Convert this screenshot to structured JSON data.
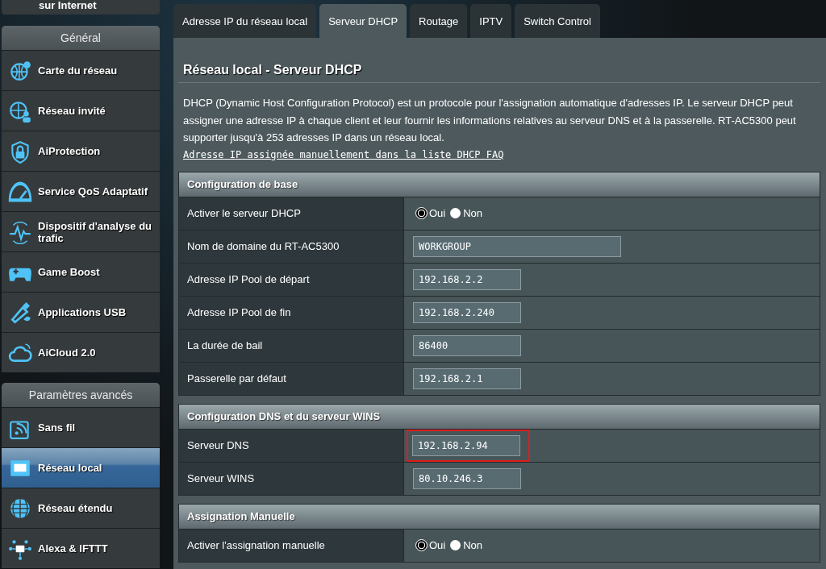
{
  "sidebar": {
    "top_item": "sur Internet",
    "sections": [
      {
        "title": "Général",
        "items": [
          {
            "label": "Carte du réseau",
            "selected": false
          },
          {
            "label": "Réseau invité",
            "selected": false
          },
          {
            "label": "AiProtection",
            "selected": false
          },
          {
            "label": "Service QoS Adaptatif",
            "selected": false
          },
          {
            "label": "Dispositif d'analyse du trafic",
            "selected": false
          },
          {
            "label": "Game Boost",
            "selected": false
          },
          {
            "label": "Applications USB",
            "selected": false
          },
          {
            "label": "AiCloud 2.0",
            "selected": false
          }
        ]
      },
      {
        "title": "Paramètres avancés",
        "items": [
          {
            "label": "Sans fil",
            "selected": false
          },
          {
            "label": "Réseau local",
            "selected": true
          },
          {
            "label": "Réseau étendu",
            "selected": false
          },
          {
            "label": "Alexa & IFTTT",
            "selected": false
          }
        ]
      }
    ]
  },
  "tabs": [
    {
      "label": "Adresse IP du réseau local",
      "selected": false
    },
    {
      "label": "Serveur DHCP",
      "selected": true
    },
    {
      "label": "Routage",
      "selected": false
    },
    {
      "label": "IPTV",
      "selected": false
    },
    {
      "label": "Switch Control",
      "selected": false
    }
  ],
  "content": {
    "title": "Réseau local - Serveur DHCP",
    "description": "DHCP (Dynamic Host Configuration Protocol) est un protocole pour l'assignation automatique d'adresses IP. Le serveur DHCP peut assigner une adresse IP à chaque client et leur fournir les informations relatives au serveur DNS et à la passerelle. RT-AC5300 peut supporter jusqu'à 253 adresses IP dans un réseau local.",
    "link": "Adresse IP assignée manuellement dans la liste DHCP FAQ",
    "sections": [
      {
        "title": "Configuration de base",
        "rows": [
          {
            "kind": "radio",
            "label": "Activer le serveur DHCP",
            "options": [
              {
                "label": "Oui",
                "selected": true
              },
              {
                "label": "Non",
                "selected": false
              }
            ]
          },
          {
            "kind": "wide_text",
            "label": "Nom de domaine du RT-AC5300",
            "value": "WORKGROUP",
            "highlighted": false
          },
          {
            "kind": "text",
            "label": "Adresse IP Pool de départ",
            "value": "192.168.2.2",
            "highlighted": false
          },
          {
            "kind": "text",
            "label": "Adresse IP Pool de fin",
            "value": "192.168.2.240",
            "highlighted": false
          },
          {
            "kind": "text",
            "label": "La durée de bail",
            "value": "86400",
            "highlighted": false
          },
          {
            "kind": "text",
            "label": "Passerelle par défaut",
            "value": "192.168.2.1",
            "highlighted": false
          }
        ]
      },
      {
        "title": "Configuration DNS et du serveur WINS",
        "rows": [
          {
            "kind": "text",
            "label": "Serveur DNS",
            "value": "192.168.2.94",
            "highlighted": true
          },
          {
            "kind": "text",
            "label": "Serveur WINS",
            "value": "80.10.246.3",
            "highlighted": false
          }
        ]
      },
      {
        "title": "Assignation Manuelle",
        "rows": [
          {
            "kind": "radio",
            "label": "Activer l'assignation manuelle",
            "options": [
              {
                "label": "Oui",
                "selected": true
              },
              {
                "label": "Non",
                "selected": false
              }
            ]
          }
        ]
      }
    ]
  }
}
